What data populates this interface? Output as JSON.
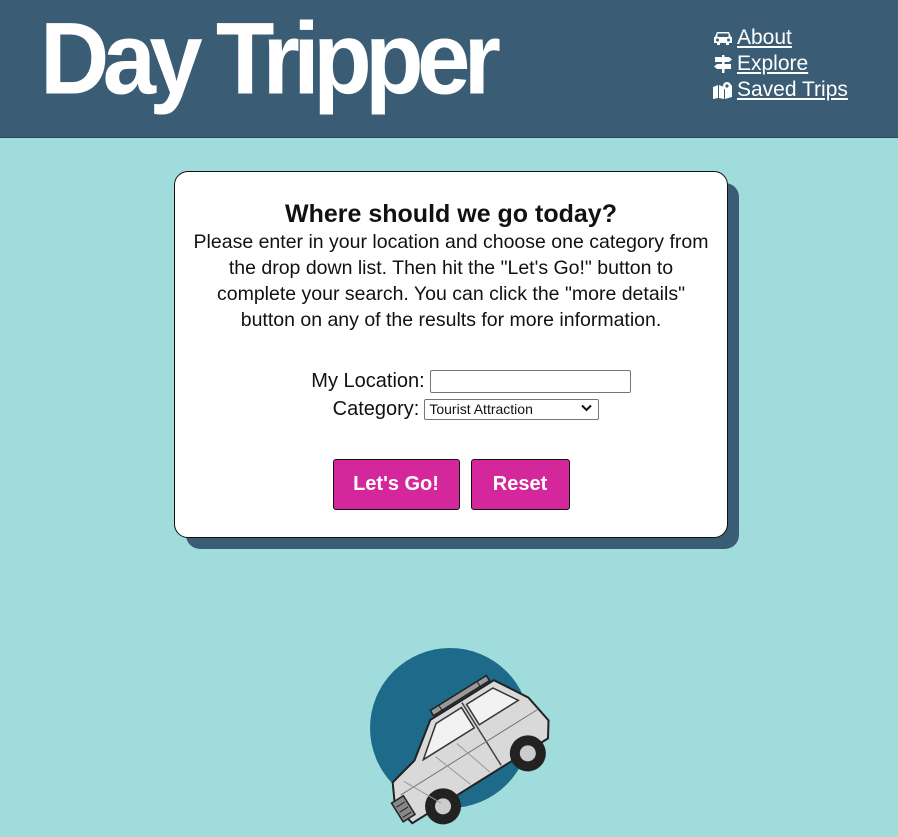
{
  "header": {
    "logo_text": "Day Tripper",
    "nav": [
      {
        "label": "About",
        "icon": "car-icon"
      },
      {
        "label": "Explore",
        "icon": "signpost-icon"
      },
      {
        "label": "Saved Trips",
        "icon": "map-icon"
      }
    ]
  },
  "card": {
    "heading": "Where should we go today?",
    "instructions": "Please enter in your location and choose one category from the drop down list. Then hit the \"Let's Go!\" button to complete your search. You can click the \"more details\" button on any of the results for more information.",
    "location_label": "My Location:",
    "location_value": "",
    "category_label": "Category:",
    "category_selected": "Tourist Attraction",
    "go_button": "Let's Go!",
    "reset_button": "Reset"
  },
  "colors": {
    "header_bg": "#3a5d75",
    "page_bg": "#a0dcdb",
    "button_bg": "#d4279b",
    "circle": "#1d6a8a"
  }
}
